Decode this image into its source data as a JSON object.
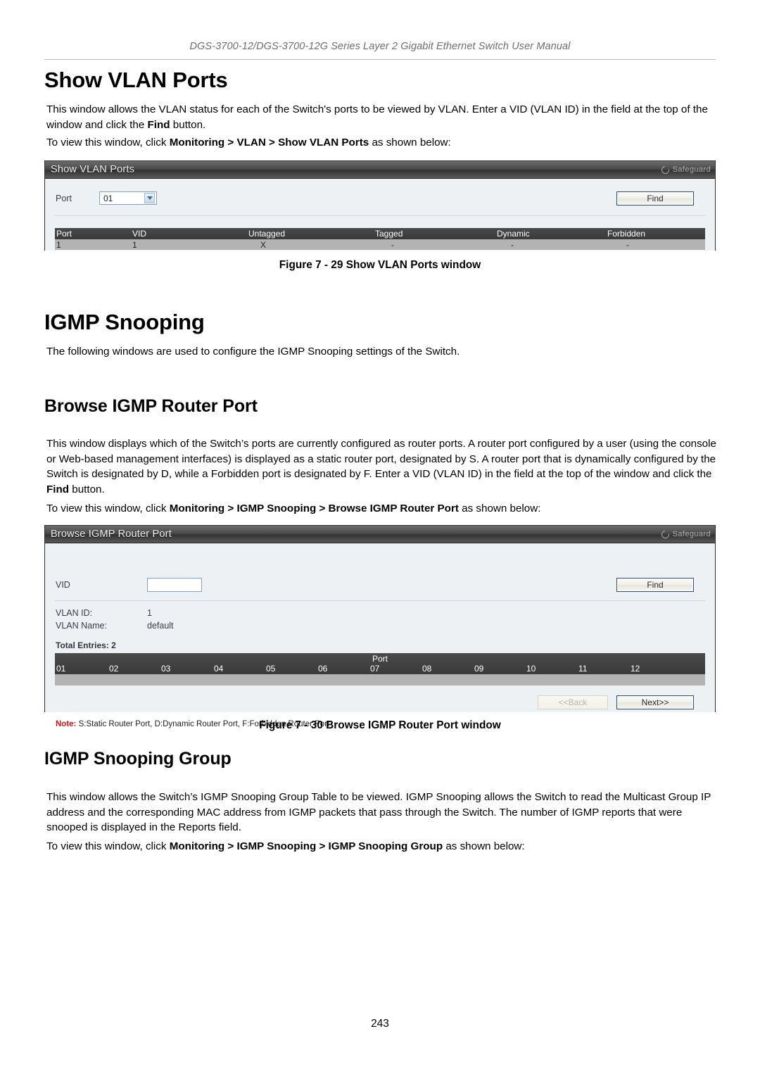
{
  "document": {
    "running_header": "DGS-3700-12/DGS-3700-12G Series Layer 2 Gigabit Ethernet Switch User Manual",
    "page_number": "243"
  },
  "sections": {
    "show_vlan_ports": {
      "heading": "Show VLAN Ports",
      "paragraph": "This window allows the VLAN status for each of the Switch's ports to be viewed by VLAN. Enter a VID (VLAN ID) in the field at the top of the window and click the <b>Find</b> button.",
      "nav_line": "To view this window, click <b>Monitoring &gt; VLAN &gt; Show VLAN Ports</b> as shown below:",
      "figure_caption": "Figure 7 - 29 Show VLAN Ports window"
    },
    "igmp_snooping": {
      "heading": "IGMP Snooping",
      "paragraph": "The following windows are used to configure the IGMP Snooping settings of the Switch."
    },
    "browse_igmp_router_port": {
      "heading": "Browse IGMP Router Port",
      "paragraph": "This window displays which of the Switch’s ports are currently configured as router ports. A router port configured by a user (using the console or Web-based management interfaces) is displayed as a static router port, designated by S. A router port that is dynamically configured by the Switch is designated by D, while a Forbidden port is designated by F. Enter a VID (VLAN ID) in the field at the top of the window and click the <b>Find</b> button.",
      "nav_line": "To view this window, click <b>Monitoring &gt; IGMP Snooping &gt; Browse IGMP Router Port</b> as shown below:",
      "figure_caption": "Figure 7 - 30 Browse IGMP Router Port window"
    },
    "igmp_snooping_group": {
      "heading": "IGMP Snooping Group",
      "paragraph": "This window allows the Switch’s IGMP Snooping Group Table to be viewed. IGMP Snooping allows the Switch to read the Multicast Group IP address and the corresponding MAC address from IGMP packets that pass through the Switch. The number of IGMP reports that were snooped is displayed in the Reports field.",
      "nav_line": "To view this window, click <b>Monitoring &gt; IGMP Snooping &gt; IGMP Snooping Group</b> as shown below:"
    }
  },
  "figure_29": {
    "window_title": "Show VLAN Ports",
    "safeguard_label": "Safeguard",
    "port_label": "Port",
    "port_value": "01",
    "find_label": "Find",
    "table": {
      "headers": [
        "Port",
        "VID",
        "Untagged",
        "Tagged",
        "Dynamic",
        "Forbidden"
      ],
      "rows": [
        [
          "1",
          "1",
          "X",
          "-",
          "-",
          "-"
        ]
      ]
    }
  },
  "figure_30": {
    "window_title": "Browse IGMP Router Port",
    "safeguard_label": "Safeguard",
    "vid_label": "VID",
    "vid_value": "",
    "vid_placeholder": "",
    "find_label": "Find",
    "vlan_id_label": "VLAN ID:",
    "vlan_id_value": "1",
    "vlan_name_label": "VLAN Name:",
    "vlan_name_value": "default",
    "total_entries": "Total Entries: 2",
    "port_group_label": "Port",
    "port_columns": [
      "01",
      "02",
      "03",
      "04",
      "05",
      "06",
      "07",
      "08",
      "09",
      "10",
      "11",
      "12"
    ],
    "port_values": [
      "",
      "",
      "",
      "",
      "",
      "",
      "",
      "",
      "",
      "",
      "",
      ""
    ],
    "back_label": "<<Back",
    "next_label": "Next>>",
    "note_prefix": "Note:",
    "note_text": "S:Static Router Port,  D:Dynamic Router Port,  F:Forbidden Router Port"
  },
  "colors": {
    "title_bar_dark": "#3a3a3a",
    "note_red": "#d01717",
    "table_row_grey": "#b3b3b3",
    "window_bg": "#eef1f4"
  }
}
